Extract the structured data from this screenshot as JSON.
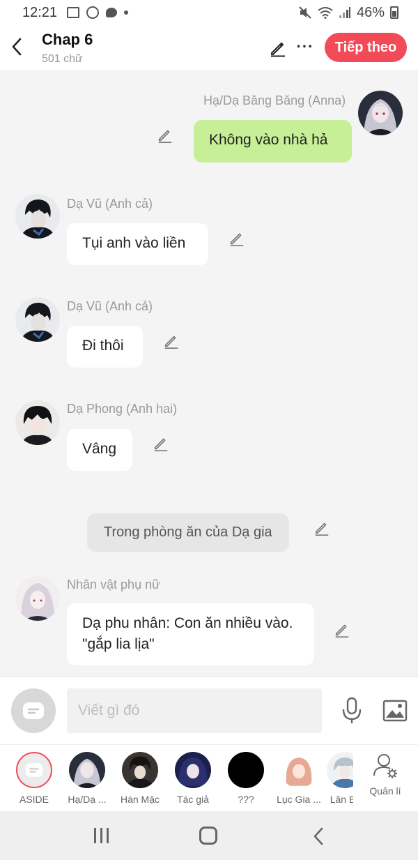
{
  "status_bar": {
    "time": "12:21",
    "battery": "46%"
  },
  "header": {
    "title": "Chap 6",
    "subtitle": "501 chữ",
    "next_label": "Tiếp theo"
  },
  "messages": [
    {
      "type": "self",
      "name": "Hạ/Dạ Băng Băng (Anna)",
      "text": "Không vào nhà hả"
    },
    {
      "type": "other",
      "name": "Dạ Vũ (Anh cả)",
      "text": "Tụi anh vào liền"
    },
    {
      "type": "other",
      "name": "Dạ Vũ (Anh cả)",
      "text": "Đi thôi"
    },
    {
      "type": "other",
      "name": "Dạ Phong (Anh hai)",
      "text": "Vâng"
    },
    {
      "type": "narration",
      "text": "Trong phòng ăn của Dạ gia"
    },
    {
      "type": "other",
      "name": "Nhân vật phụ nữ",
      "text": "Dạ phu nhân: Con ăn nhiều vào. \"gắp lia lịa\""
    }
  ],
  "input": {
    "placeholder": "Viết gì đó"
  },
  "characters": [
    {
      "label": "ASIDE"
    },
    {
      "label": "Hạ/Dạ ..."
    },
    {
      "label": "Hàn Mặc"
    },
    {
      "label": "Tác giả"
    },
    {
      "label": "???"
    },
    {
      "label": "Lục Gia ..."
    },
    {
      "label": "Lân B"
    }
  ],
  "manage_label": "Quản lí",
  "colors": {
    "accent": "#f24b57",
    "self_bubble": "#c7ef98",
    "other_bubble": "#ffffff",
    "narration_bubble": "#e6e6e6"
  }
}
